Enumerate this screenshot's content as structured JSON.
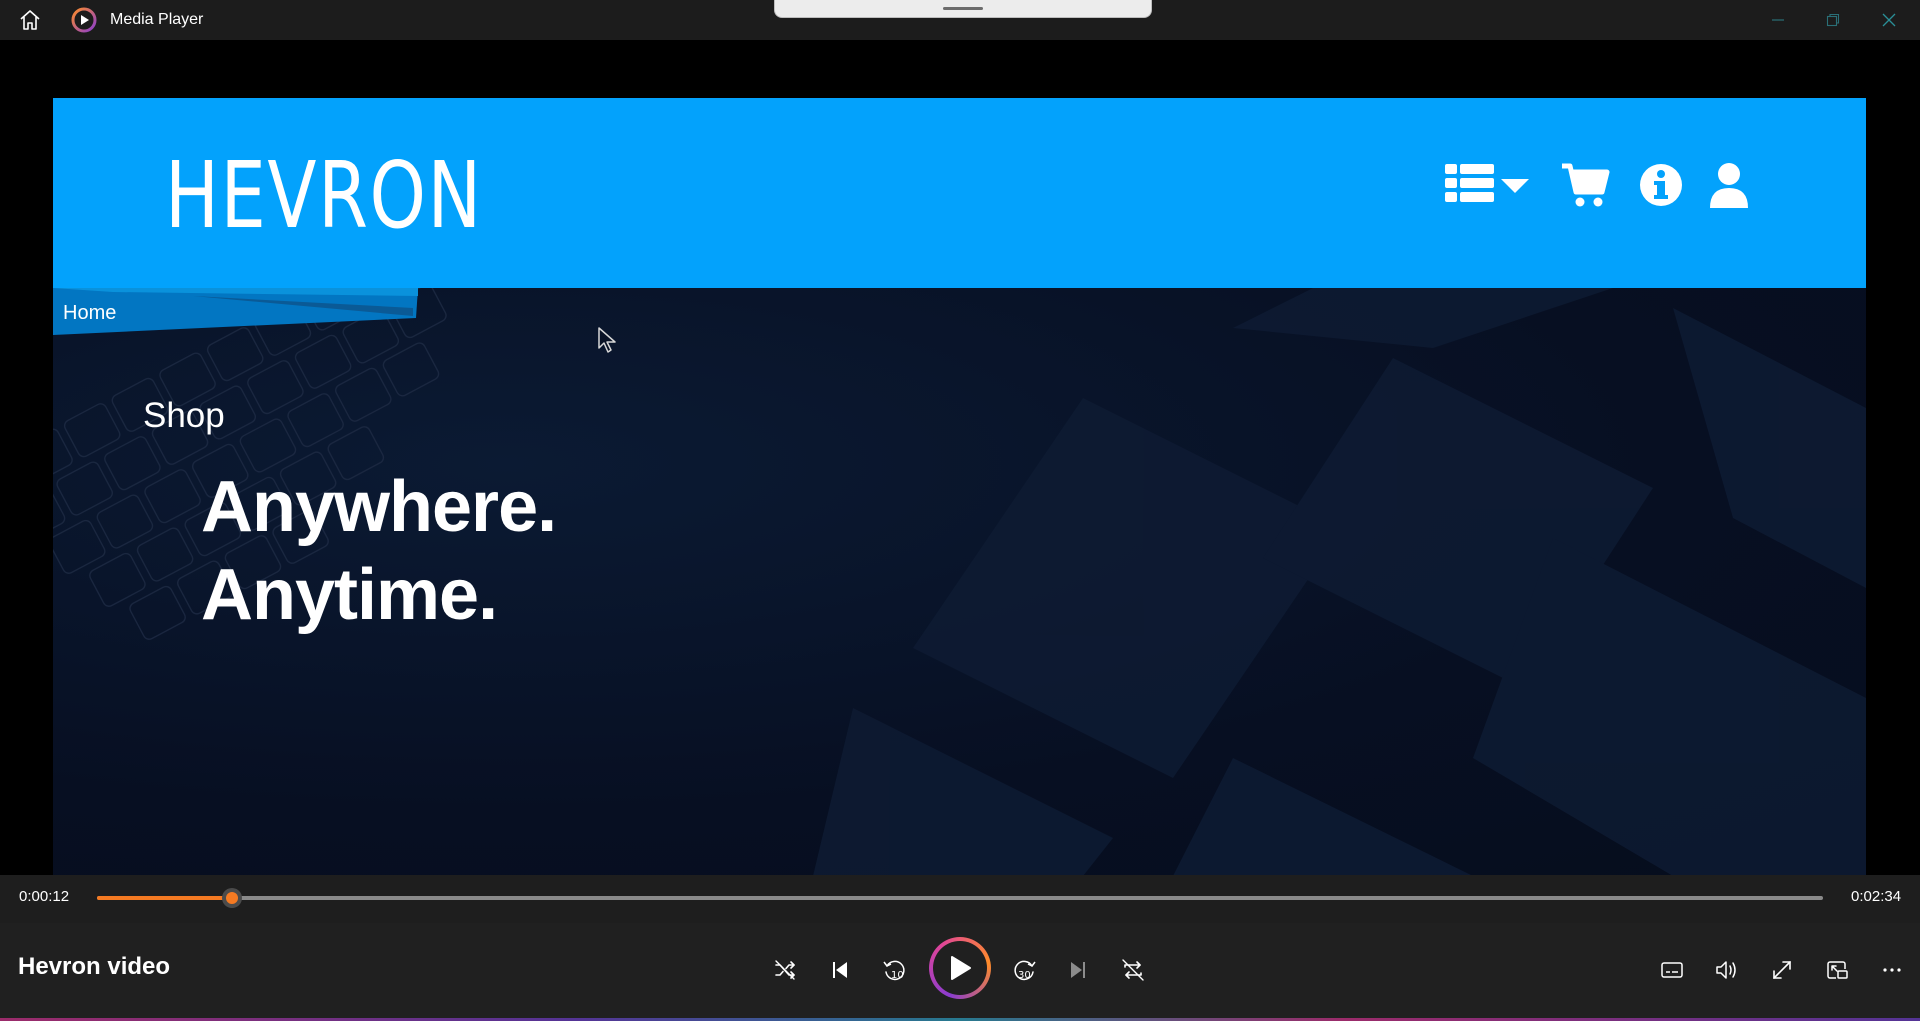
{
  "window": {
    "title": "Media Player",
    "icons": {
      "home": "home-icon",
      "app": "media-player-app-icon",
      "minimize": "minimize-icon",
      "restore": "restore-icon",
      "close": "close-icon"
    }
  },
  "video": {
    "site": {
      "logo": "HEVRON",
      "header_color": "#03a2fc",
      "header_icons": [
        "list-menu-icon",
        "cart-icon",
        "info-icon",
        "user-icon"
      ]
    },
    "breadcrumb": "Home",
    "hero": {
      "small": "Shop",
      "line1": "Anywhere.",
      "line2": "Anytime."
    }
  },
  "player": {
    "current_time": "0:00:12",
    "total_time": "0:02:34",
    "progress_fraction": 0.078,
    "media_title": "Hevron video",
    "accent_color": "#f57a22",
    "controls_center": [
      "shuffle-icon",
      "previous-icon",
      "skip-back-10-icon",
      "play-icon",
      "skip-forward-30-icon",
      "next-icon",
      "repeat-icon"
    ],
    "controls_right": [
      "subtitles-icon",
      "volume-icon",
      "fullscreen-icon",
      "mini-player-icon",
      "more-options-icon"
    ]
  }
}
